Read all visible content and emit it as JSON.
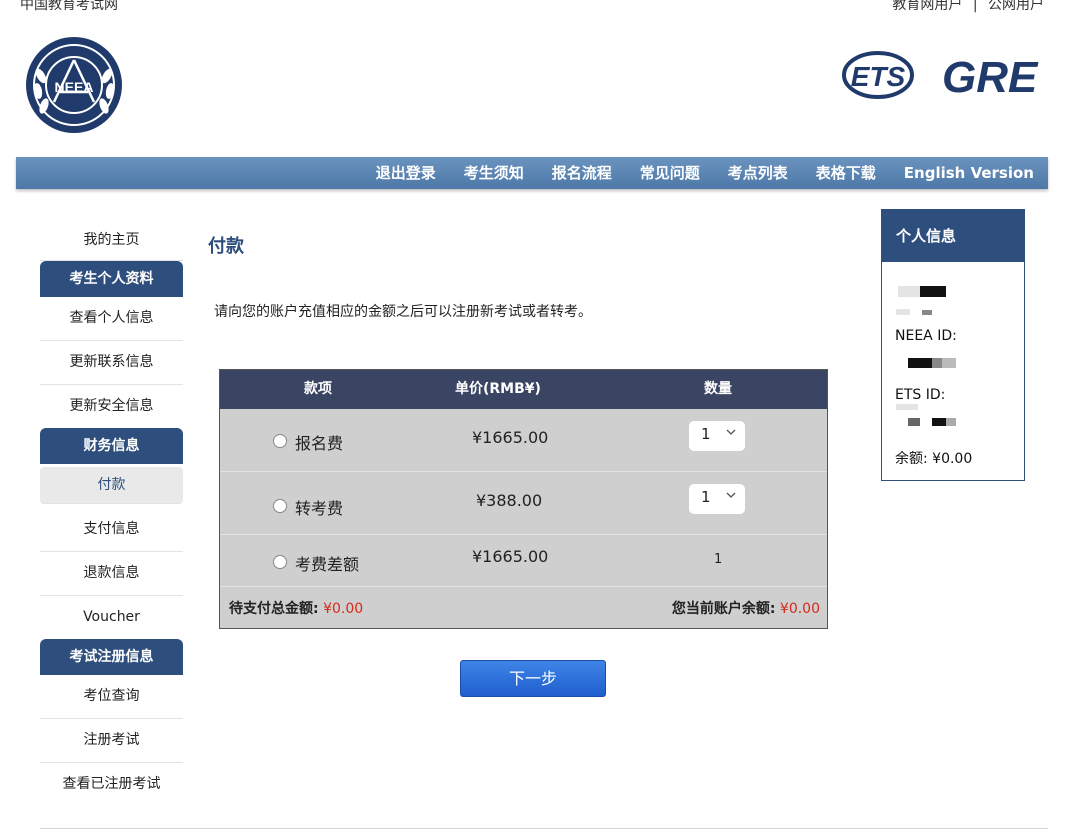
{
  "top": {
    "site_name": "中国教育考试网",
    "link_edu_user": "教育网用户",
    "separator": "|",
    "link_public_user": "公网用户"
  },
  "logos": {
    "neea": "NEEA",
    "ets": "ETS",
    "gre": "GRE"
  },
  "nav": {
    "items": [
      "退出登录",
      "考生须知",
      "报名流程",
      "常见问题",
      "考点列表",
      "表格下载",
      "English Version"
    ]
  },
  "sidebar": {
    "home": "我的主页",
    "sec1_title": "考生个人资料",
    "view_info": "查看个人信息",
    "update_contact": "更新联系信息",
    "update_security": "更新安全信息",
    "sec2_title": "财务信息",
    "payment": "付款",
    "payment_info": "支付信息",
    "refund_info": "退款信息",
    "voucher": "Voucher",
    "sec3_title": "考试注册信息",
    "seat_query": "考位查询",
    "register_exam": "注册考试",
    "view_registered": "查看已注册考试"
  },
  "main": {
    "title": "付款",
    "notice": "请向您的账户充值相应的金额之后可以注册新考试或者转考。",
    "table": {
      "headers": [
        "款项",
        "单价(RMB¥)",
        "数量"
      ],
      "rows": [
        {
          "item": "报名费",
          "price": "¥1665.00",
          "qty": "1",
          "qty_selectable": true
        },
        {
          "item": "转考费",
          "price": "¥388.00",
          "qty": "1",
          "qty_selectable": true
        },
        {
          "item": "考费差额",
          "price": "¥1665.00",
          "qty": "1",
          "qty_selectable": false
        }
      ],
      "total_label": "待支付总金额:",
      "total_value": "¥0.00",
      "balance_label": "您当前账户余额:",
      "balance_value": "¥0.00"
    },
    "next_button": "下一步"
  },
  "info_panel": {
    "title": "个人信息",
    "neea_id_label": "NEEA ID:",
    "ets_id_label": "ETS ID:",
    "balance": "余额: ¥0.00"
  },
  "colors": {
    "brand_blue": "#2e4f7e",
    "nav_blue": "#5a84b3",
    "table_header": "#3a4463",
    "table_body": "#cfcfcf",
    "alert_red": "#d62a1a",
    "button_blue": "#2b6fdb"
  }
}
